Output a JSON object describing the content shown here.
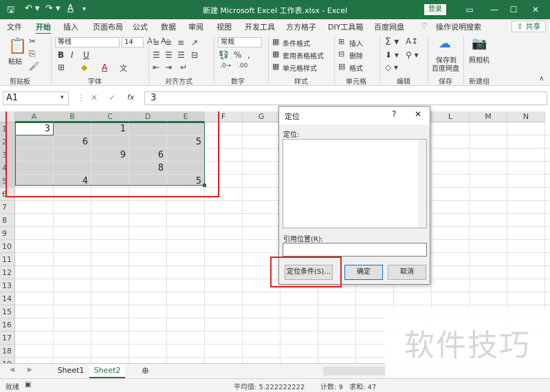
{
  "titlebar": {
    "title": "新建 Microsoft Excel 工作表.xlsx  -  Excel",
    "login": "登录",
    "save_icon": "save-icon",
    "undo_icon": "undo-icon",
    "redo_icon": "redo-icon",
    "font_color_icon": "font-color-icon"
  },
  "tabs": [
    "文件",
    "开始",
    "插入",
    "页面布局",
    "公式",
    "数据",
    "审阅",
    "视图",
    "开发工具",
    "方方格子",
    "DIY工具箱",
    "百度网盘"
  ],
  "search_label": "操作说明搜索",
  "share_label": "共享",
  "ribbon": {
    "clipboard": {
      "paste": "粘贴",
      "group": "剪贴板"
    },
    "font": {
      "name": "等线",
      "size": "14",
      "bold": "B",
      "italic": "I",
      "underline": "U",
      "font_a": "A",
      "group": "字体"
    },
    "align": {
      "group": "对齐方式"
    },
    "number": {
      "format": "常规",
      "group": "数字"
    },
    "styles": {
      "cond": "条件格式",
      "table": "套用表格格式",
      "cell": "单元格样式",
      "group": "样式"
    },
    "cells": {
      "insert": "插入",
      "delete": "删除",
      "format": "格式",
      "group": "单元格"
    },
    "editing": {
      "group": "编辑"
    },
    "save": {
      "line1": "保存到",
      "line2": "百度网盘",
      "group": "保存"
    },
    "camera": {
      "label": "照相机",
      "group": "新建组"
    }
  },
  "formula": {
    "namebox": "A1",
    "fx": "fx",
    "value": "3"
  },
  "columns": [
    "A",
    "B",
    "C",
    "D",
    "E",
    "F",
    "G",
    "H",
    "I",
    "J",
    "K",
    "L",
    "M",
    "N"
  ],
  "rows": [
    "1",
    "2",
    "3",
    "4",
    "5",
    "6",
    "7",
    "8",
    "9",
    "10",
    "11",
    "12",
    "13",
    "14",
    "15",
    "16",
    "17",
    "18",
    "19"
  ],
  "cells": [
    {
      "ref": "A1",
      "value": "3"
    },
    {
      "ref": "C1",
      "value": "1"
    },
    {
      "ref": "B2",
      "value": "6"
    },
    {
      "ref": "E2",
      "value": "5"
    },
    {
      "ref": "C3",
      "value": "9"
    },
    {
      "ref": "D3",
      "value": "6"
    },
    {
      "ref": "D4",
      "value": "8"
    },
    {
      "ref": "B5",
      "value": "4"
    },
    {
      "ref": "E5",
      "value": "5"
    }
  ],
  "sheets": [
    "Sheet1",
    "Sheet2"
  ],
  "active_sheet": "Sheet2",
  "status": {
    "avg": "平均值: 5.222222222",
    "count": "计数: 9",
    "sum": "求和: 47"
  },
  "dialog": {
    "title": "定位",
    "help": "?",
    "close": "✕",
    "list_label": "定位:",
    "ref_label": "引用位置(R):",
    "special_button": "定位条件(S)...",
    "ok_button": "确定",
    "cancel_button": "取消"
  },
  "watermark": "软件技巧",
  "colors": {
    "accent": "#217346",
    "highlight": "#e02020"
  }
}
